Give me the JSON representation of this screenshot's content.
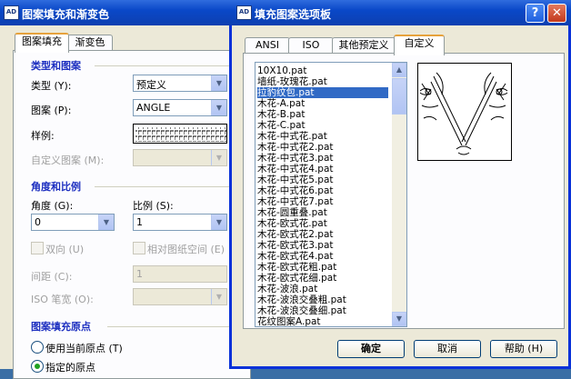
{
  "back_dialog": {
    "title": "图案填充和渐变色",
    "tabs": [
      "图案填充",
      "渐变色"
    ],
    "group_type_pattern": {
      "title": "类型和图案",
      "type_label": "类型 (Y):",
      "type_value": "预定义",
      "pattern_label": "图案 (P):",
      "pattern_value": "ANGLE",
      "swatch_label": "样例:",
      "custom_label": "自定义图案 (M):"
    },
    "group_angle_scale": {
      "title": "角度和比例",
      "angle_label": "角度 (G):",
      "angle_value": "0",
      "scale_label": "比例 (S):",
      "scale_value": "1",
      "double_label": "双向 (U)",
      "relative_label": "相对图纸空间 (E)",
      "spacing_label": "间距 (C):",
      "spacing_value": "1",
      "iso_label": "ISO 笔宽 (O):"
    },
    "group_origin": {
      "title": "图案填充原点",
      "use_current": "使用当前原点 (T)",
      "specified": "指定的原点"
    }
  },
  "front_dialog": {
    "title": "填充图案选项板",
    "help_glyph": "?",
    "close_glyph": "✕",
    "tabs": [
      "ANSI",
      "ISO",
      "其他预定义",
      "自定义"
    ],
    "active_tab": "自定义",
    "patterns": [
      "10X10.pat",
      "墙纸-玫瑰花.pat",
      "拉豹纹包.pat",
      "木花-A.pat",
      "木花-B.pat",
      "木花-C.pat",
      "木花-中式花.pat",
      "木花-中式花2.pat",
      "木花-中式花3.pat",
      "木花-中式花4.pat",
      "木花-中式花5.pat",
      "木花-中式花6.pat",
      "木花-中式花7.pat",
      "木花-圆重叠.pat",
      "木花-欧式花.pat",
      "木花-欧式花2.pat",
      "木花-欧式花3.pat",
      "木花-欧式花4.pat",
      "木花-欧式花粗.pat",
      "木花-欧式花细.pat",
      "木花-波浪.pat",
      "木花-波浪交叠粗.pat",
      "木花-波浪交叠细.pat",
      "花纹图案A.pat"
    ],
    "selected_index": 2,
    "buttons": {
      "ok": "确定",
      "cancel": "取消",
      "help": "帮助 (H)"
    }
  }
}
